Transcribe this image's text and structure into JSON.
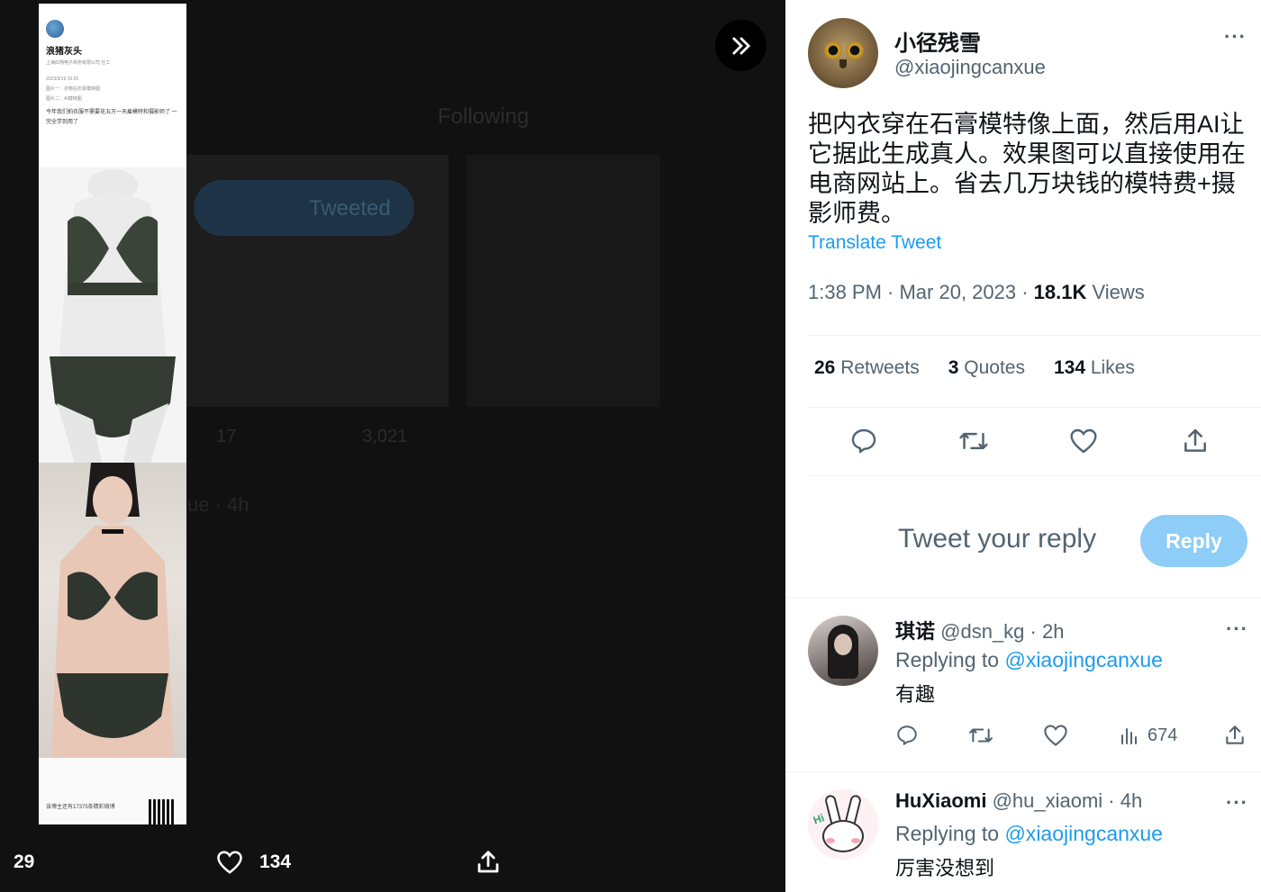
{
  "media": {
    "strip": {
      "author": "浪猪灰头",
      "sub": "上海红翔电子商务有限公司 仕工",
      "date": "2023/3/19 16:26",
      "line1": "图片一：衣物在石膏模特图",
      "line2": "图片二：AI模特图",
      "body": "今年我们拍衣服不需要花五万一天雇模特和摄影师了 一完全学到用了",
      "footer": "该博主还有17375条精彩微博"
    },
    "bottom": {
      "left_count": "29",
      "like_count": "134"
    },
    "background": {
      "tab_following": "Following",
      "tweeted_label": "Tweeted",
      "bg_time": "ue · 4h",
      "bg_views": "3,021",
      "bg_likes": "17"
    }
  },
  "tweet": {
    "author_name": "小径残雪",
    "author_handle": "@xiaojingcanxue",
    "text": "把内衣穿在石膏模特像上面，然后用AI让它据此生成真人。效果图可以直接使用在电商网站上。省去几万块钱的模特费+摄影师费。",
    "translate": "Translate Tweet",
    "time": "1:38 PM · Mar 20, 2023 · ",
    "views_count": "18.1K",
    "views_label": " Views",
    "retweets_count": "26",
    "retweets_label": " Retweets",
    "quotes_count": "3",
    "quotes_label": " Quotes",
    "likes_count": "134",
    "likes_label": " Likes"
  },
  "reply_box": {
    "placeholder": "Tweet your reply",
    "button": "Reply"
  },
  "replies": [
    {
      "name": "琪诺",
      "handle": " @dsn_kg · 2h",
      "replying_prefix": "Replying to ",
      "replying_to": "@xiaojingcanxue",
      "text": "有趣",
      "views": "674"
    },
    {
      "name": "HuXiaomi",
      "handle": " @hu_xiaomi · 4h",
      "replying_prefix": "Replying to ",
      "replying_to": "@xiaojingcanxue",
      "text": "厉害没想到"
    }
  ],
  "colors": {
    "accent": "#1d9bf0",
    "reply_button": "#8ecdf7",
    "muted": "#536471"
  }
}
